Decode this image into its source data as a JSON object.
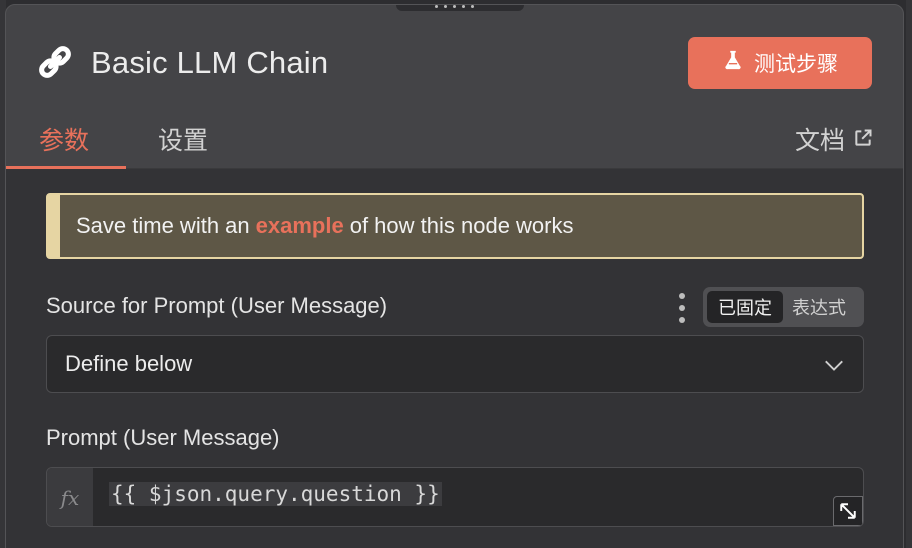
{
  "header": {
    "title": "Basic LLM Chain",
    "test_step_label": "测试步骤"
  },
  "tabs": [
    {
      "label": "参数",
      "active": true
    },
    {
      "label": "设置",
      "active": false
    }
  ],
  "docs_link": "文档",
  "notice": {
    "prefix": "Save time with an",
    "link": "example",
    "suffix": "of how this node works"
  },
  "fields": {
    "source_label": "Source for Prompt (User Message)",
    "mode_fixed": "已固定",
    "mode_expression": "表达式",
    "source_value": "Define below",
    "prompt_label": "Prompt (User Message)",
    "prompt_fx": "fx",
    "prompt_value": "{{ $json.query.question }}"
  },
  "colors": {
    "accent": "#e8715b",
    "panel": "#444447",
    "content_bg": "#333336",
    "notice_bg": "#5e5746",
    "notice_border": "#e6d5a3"
  },
  "icons": {
    "title": "link-icon",
    "test_step": "flask-icon",
    "docs": "external-link-icon",
    "select": "chevron-down-icon",
    "prompt": "expand-icon",
    "options": "kebab-menu-icon"
  }
}
